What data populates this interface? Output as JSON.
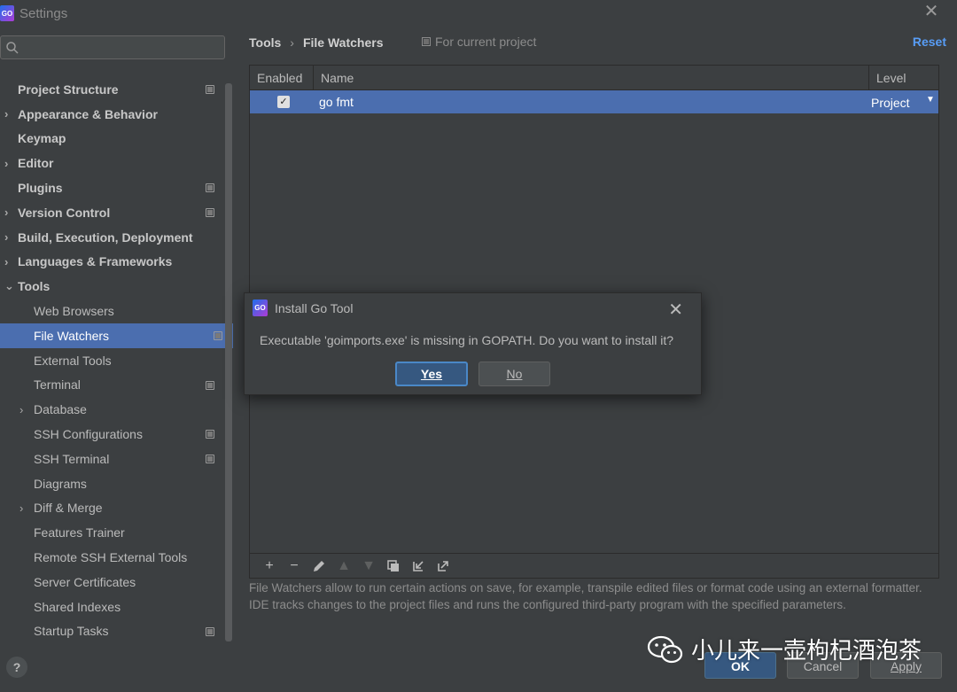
{
  "window": {
    "title": "Settings",
    "logo_text": "GO"
  },
  "sidebar": {
    "search_placeholder": "",
    "items": [
      {
        "label": "Project Structure",
        "level": 0,
        "bold": true,
        "chevron": "",
        "project_icon": true
      },
      {
        "label": "Appearance & Behavior",
        "level": 0,
        "bold": true,
        "chevron": "›",
        "project_icon": false
      },
      {
        "label": "Keymap",
        "level": 0,
        "bold": true,
        "chevron": "",
        "project_icon": false
      },
      {
        "label": "Editor",
        "level": 0,
        "bold": true,
        "chevron": "›",
        "project_icon": false
      },
      {
        "label": "Plugins",
        "level": 0,
        "bold": true,
        "chevron": "",
        "project_icon": true
      },
      {
        "label": "Version Control",
        "level": 0,
        "bold": true,
        "chevron": "›",
        "project_icon": true
      },
      {
        "label": "Build, Execution, Deployment",
        "level": 0,
        "bold": true,
        "chevron": "›",
        "project_icon": false
      },
      {
        "label": "Languages & Frameworks",
        "level": 0,
        "bold": true,
        "chevron": "›",
        "project_icon": false
      },
      {
        "label": "Tools",
        "level": 0,
        "bold": true,
        "chevron": "⌄",
        "project_icon": false
      },
      {
        "label": "Web Browsers",
        "level": 1,
        "bold": false,
        "chevron": "",
        "project_icon": false
      },
      {
        "label": "File Watchers",
        "level": 1,
        "bold": false,
        "chevron": "",
        "project_icon": true,
        "selected": true
      },
      {
        "label": "External Tools",
        "level": 1,
        "bold": false,
        "chevron": "",
        "project_icon": false
      },
      {
        "label": "Terminal",
        "level": 1,
        "bold": false,
        "chevron": "",
        "project_icon": true
      },
      {
        "label": "Database",
        "level": 1,
        "bold": false,
        "chevron": "›",
        "project_icon": false
      },
      {
        "label": "SSH Configurations",
        "level": 1,
        "bold": false,
        "chevron": "",
        "project_icon": true
      },
      {
        "label": "SSH Terminal",
        "level": 1,
        "bold": false,
        "chevron": "",
        "project_icon": true
      },
      {
        "label": "Diagrams",
        "level": 1,
        "bold": false,
        "chevron": "",
        "project_icon": false
      },
      {
        "label": "Diff & Merge",
        "level": 1,
        "bold": false,
        "chevron": "›",
        "project_icon": false
      },
      {
        "label": "Features Trainer",
        "level": 1,
        "bold": false,
        "chevron": "",
        "project_icon": false
      },
      {
        "label": "Remote SSH External Tools",
        "level": 1,
        "bold": false,
        "chevron": "",
        "project_icon": false
      },
      {
        "label": "Server Certificates",
        "level": 1,
        "bold": false,
        "chevron": "",
        "project_icon": false
      },
      {
        "label": "Shared Indexes",
        "level": 1,
        "bold": false,
        "chevron": "",
        "project_icon": false
      },
      {
        "label": "Startup Tasks",
        "level": 1,
        "bold": false,
        "chevron": "",
        "project_icon": true
      }
    ]
  },
  "content": {
    "breadcrumb": [
      "Tools",
      "File Watchers"
    ],
    "breadcrumb_sep": "›",
    "scope_label": "For current project",
    "reset_label": "Reset",
    "table": {
      "columns": [
        "Enabled",
        "Name",
        "Level"
      ],
      "rows": [
        {
          "enabled": true,
          "name": "go fmt",
          "level": "Project"
        }
      ]
    },
    "toolbar": [
      "add-icon",
      "remove-icon",
      "edit-icon",
      "move-up-icon",
      "move-down-icon",
      "copy-icon",
      "import-icon",
      "export-icon"
    ],
    "description": "File Watchers allow to run certain actions on save, for example, transpile edited files or format code using an external formatter. IDE tracks changes to the project files and runs the configured third-party program with the specified parameters."
  },
  "dialog": {
    "title": "Install Go Tool",
    "message": "Executable 'goimports.exe' is missing in GOPATH. Do you want to install it?",
    "yes_label": "Yes",
    "no_label": "No"
  },
  "footer": {
    "help_label": "?",
    "ok_label": "OK",
    "cancel_label": "Cancel",
    "apply_label": "Apply"
  },
  "watermark": {
    "text": "小儿来一壶枸杞酒泡茶"
  },
  "colors": {
    "background": "#3c3f41",
    "selection": "#4b6eaf",
    "link": "#589df6",
    "primary_button": "#365880"
  }
}
